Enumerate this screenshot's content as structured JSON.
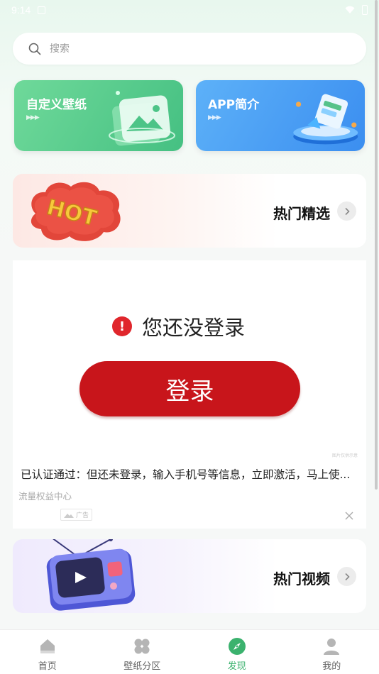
{
  "status_bar": {
    "time": "9:14"
  },
  "search": {
    "placeholder": "搜索"
  },
  "feature_cards": [
    {
      "title": "自定义壁纸",
      "arrows": "▶▶▶",
      "color": "#4cc487"
    },
    {
      "title": "APP简介",
      "arrows": "▶▶▶",
      "color": "#459cf4"
    }
  ],
  "banners": {
    "hot": {
      "title": "热门精选",
      "art_text": "HOT"
    },
    "video": {
      "title": "热门视频"
    }
  },
  "ad": {
    "warning_icon": "!",
    "warning_text": "您还没登录",
    "login_label": "登录",
    "tiny_text": "图片仅供示意",
    "description": "已认证通过：但还未登录，输入手机号等信息，立即激活，马上使...",
    "source": "流量权益中心",
    "badge": "广告",
    "accent_color": "#c8151b"
  },
  "bottom_nav": [
    {
      "label": "首页",
      "icon": "home-icon",
      "active": false
    },
    {
      "label": "壁纸分区",
      "icon": "grid-icon",
      "active": false
    },
    {
      "label": "发现",
      "icon": "compass-icon",
      "active": true
    },
    {
      "label": "我的",
      "icon": "user-icon",
      "active": false
    }
  ],
  "colors": {
    "active_nav": "#3bb26e",
    "inactive_nav": "#9a9a9a"
  }
}
